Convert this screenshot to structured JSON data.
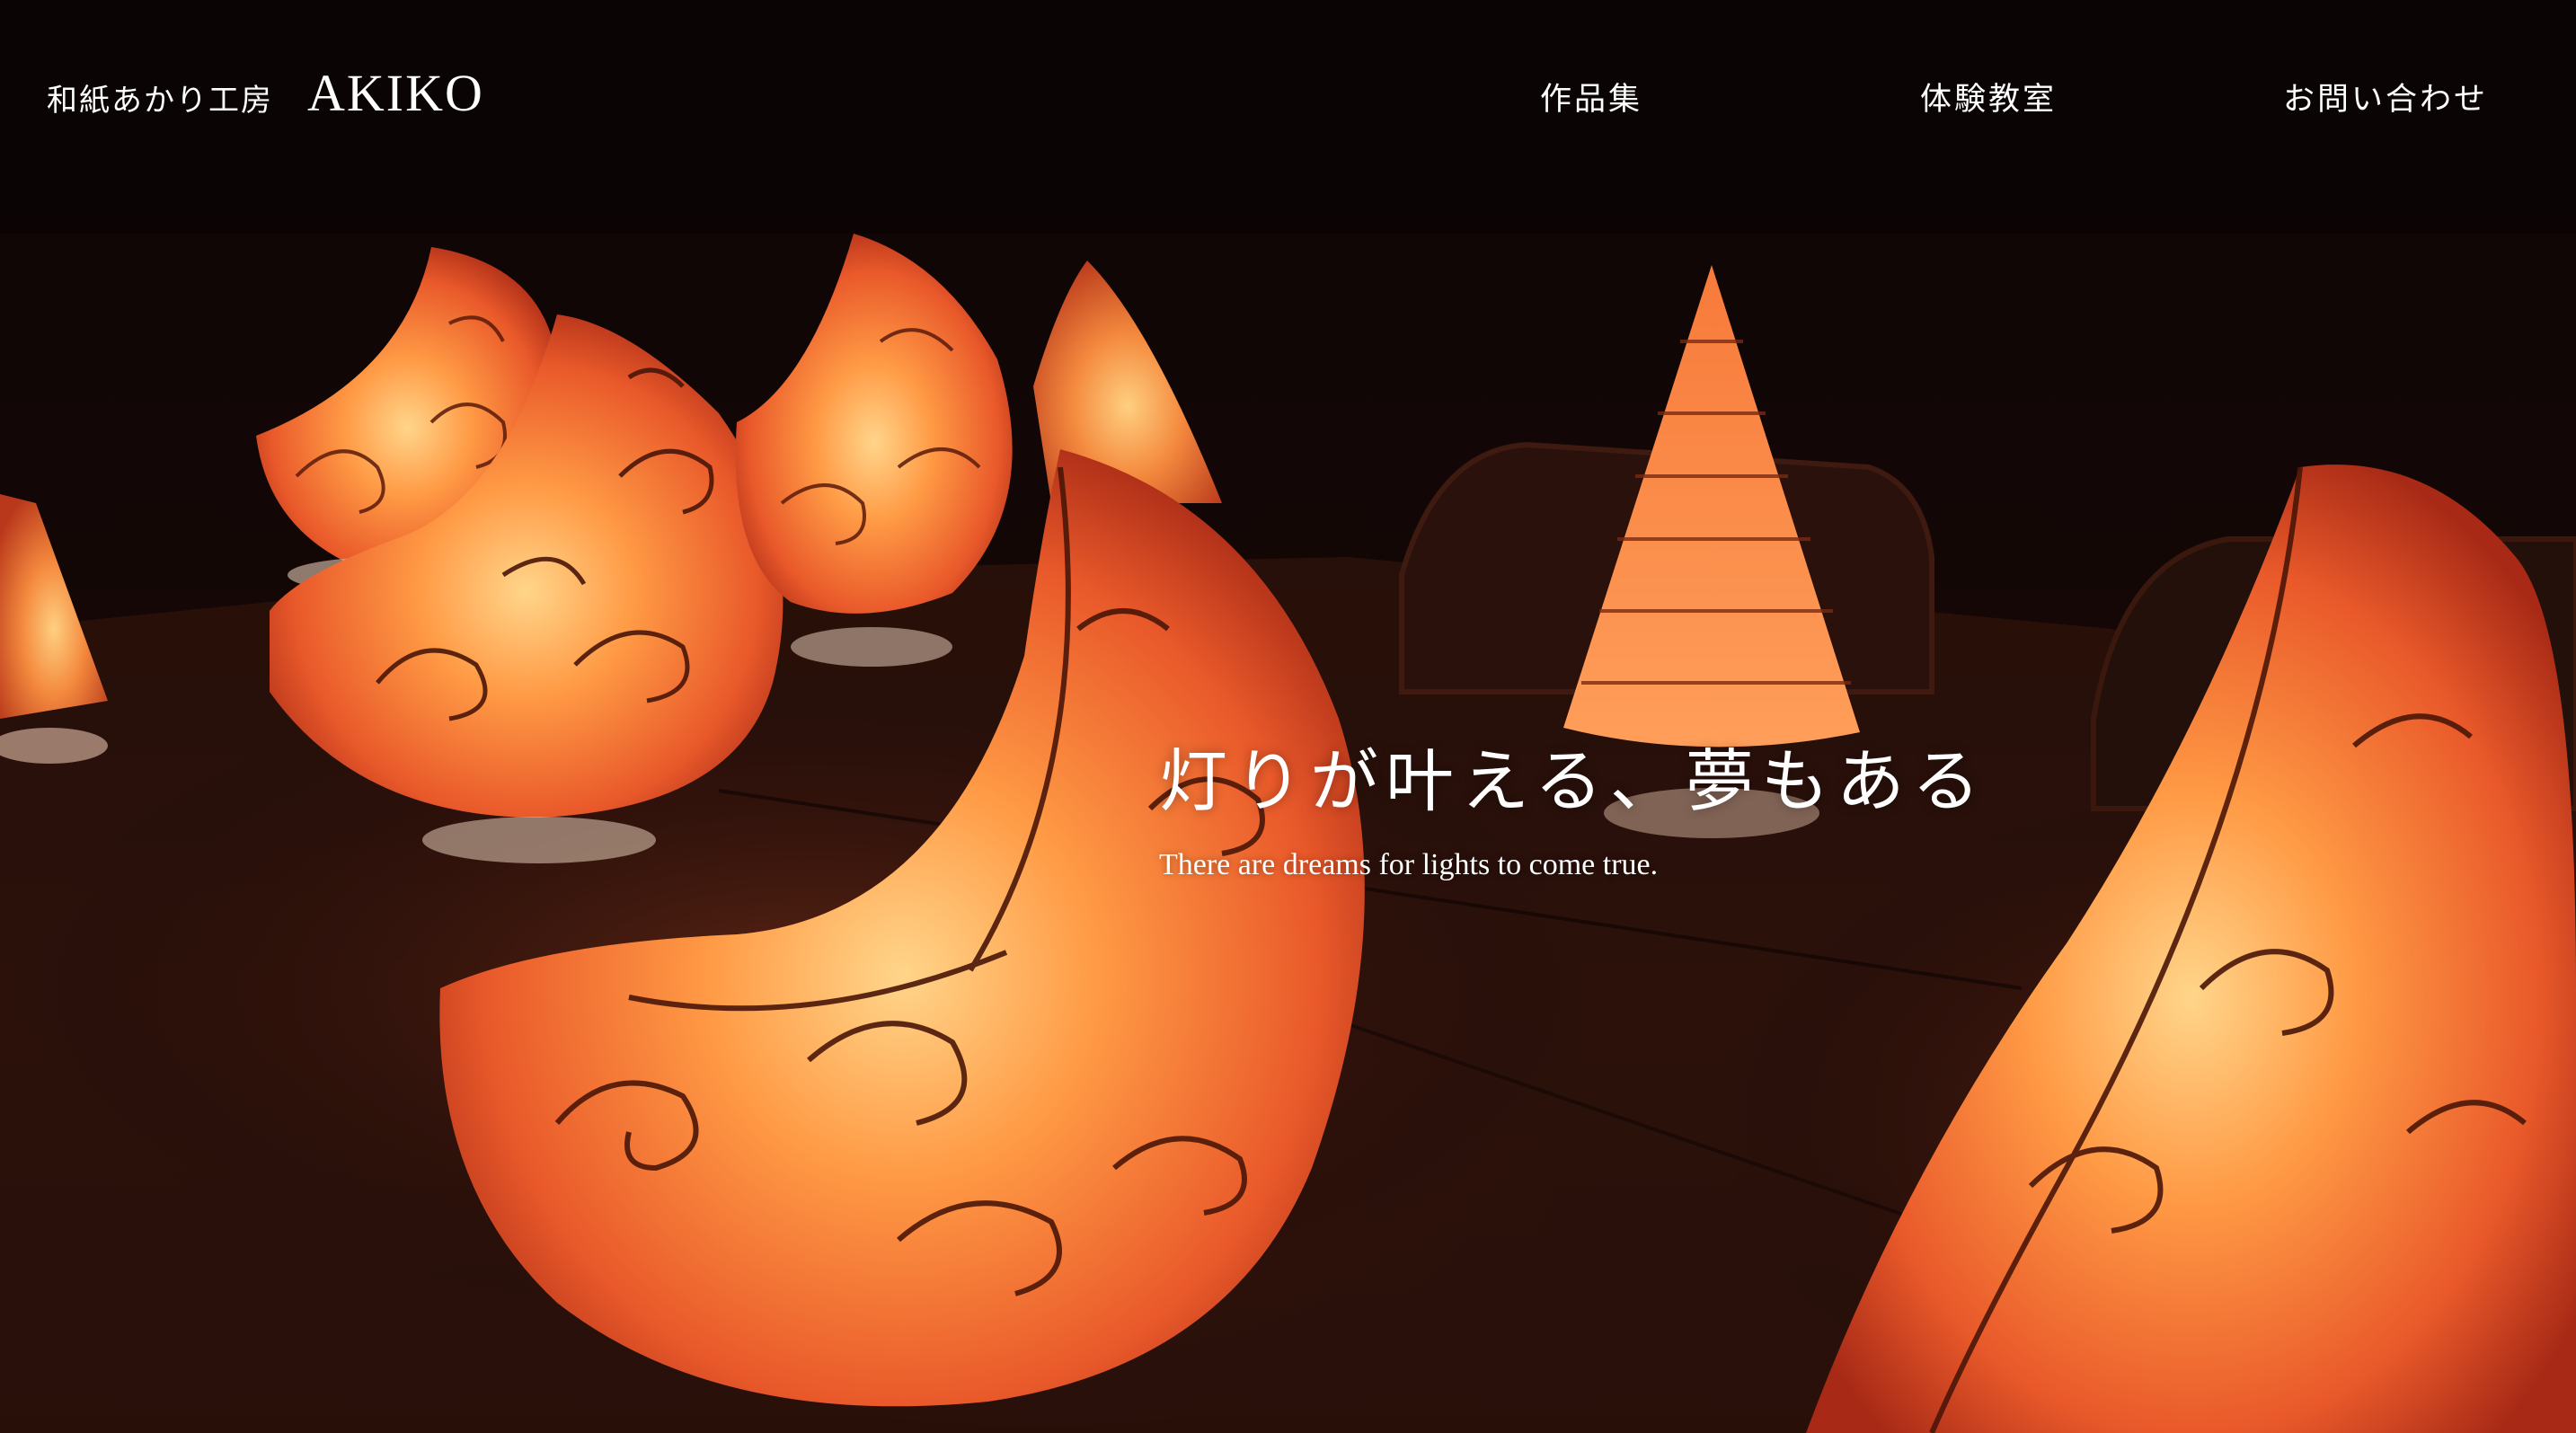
{
  "site": {
    "logo_sub": "和紙あかり工房",
    "logo_main": "AKIKO"
  },
  "nav": {
    "items": [
      {
        "label": "作品集"
      },
      {
        "label": "体験教室"
      },
      {
        "label": "お問い合わせ"
      }
    ]
  },
  "hero": {
    "title": "灯りが叶える、夢もある",
    "subtitle": "There are dreams for lights to come true."
  },
  "colors": {
    "lamp_glow": "#ffb24a",
    "lamp_mid": "#f06a2c",
    "lamp_edge": "#b5331b",
    "frame_wire": "#4a1608",
    "background": "#0c0504"
  }
}
